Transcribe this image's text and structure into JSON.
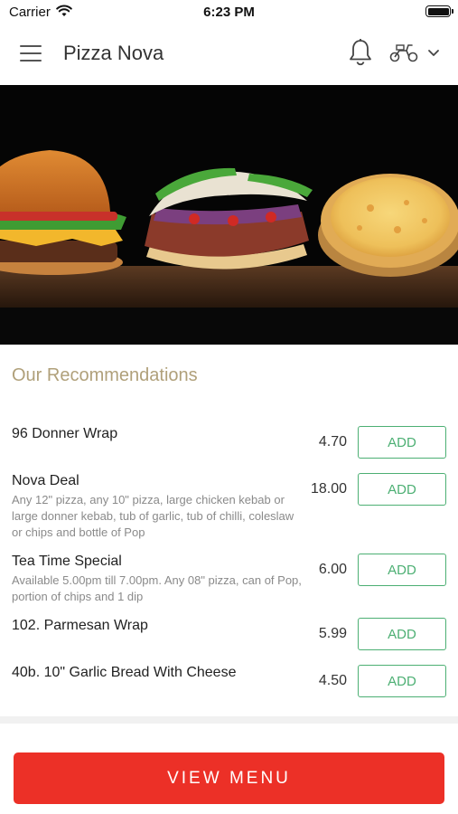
{
  "status_bar": {
    "carrier": "Carrier",
    "time": "6:23 PM"
  },
  "header": {
    "title": "Pizza Nova",
    "icons": [
      "menu-icon",
      "bell-icon",
      "scooter-icon",
      "chevron-down-icon"
    ]
  },
  "hero": {
    "image": "burger, donner kebab and pizza on wooden board"
  },
  "recommendations": {
    "title": "Our Recommendations",
    "add_label": "ADD",
    "items": [
      {
        "name": "96 Donner Wrap",
        "description": "",
        "price": "4.70"
      },
      {
        "name": "Nova Deal",
        "description": "Any 12\" pizza, any 10\" pizza, large chicken kebab or large donner kebab, tub of garlic, tub of chilli, coleslaw or chips and bottle of Pop",
        "price": "18.00"
      },
      {
        "name": "Tea Time Special",
        "description": "Available 5.00pm till 7.00pm. Any 08\" pizza, can of Pop, portion of chips and 1 dip",
        "price": "6.00"
      },
      {
        "name": "102. Parmesan Wrap",
        "description": "",
        "price": "5.99"
      },
      {
        "name": "40b. 10\" Garlic Bread With Cheese",
        "description": "",
        "price": "4.50"
      }
    ]
  },
  "footer": {
    "view_menu_label": "VIEW MENU"
  },
  "colors": {
    "accent_red": "#ec3027",
    "add_green": "#4caf73",
    "section_title": "#b0a07a"
  }
}
